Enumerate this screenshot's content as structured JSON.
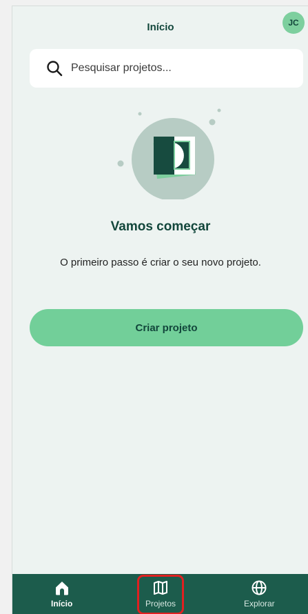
{
  "header": {
    "title": "Início",
    "avatar_initials": "JC"
  },
  "search": {
    "placeholder": "Pesquisar projetos...",
    "value": ""
  },
  "empty_state": {
    "heading": "Vamos começar",
    "description": "O primeiro passo é criar o seu novo projeto.",
    "cta_label": "Criar projeto"
  },
  "tabbar": {
    "items": [
      {
        "label": "Início",
        "icon": "home-icon",
        "active": true
      },
      {
        "label": "Projetos",
        "icon": "map-icon",
        "active": false,
        "highlighted": true
      },
      {
        "label": "Explorar",
        "icon": "globe-icon",
        "active": false
      }
    ]
  },
  "colors": {
    "background": "#edf3f1",
    "primary_dark": "#12463b",
    "accent": "#72cf99",
    "tabbar": "#1c5c4c",
    "highlight": "#e02020"
  }
}
